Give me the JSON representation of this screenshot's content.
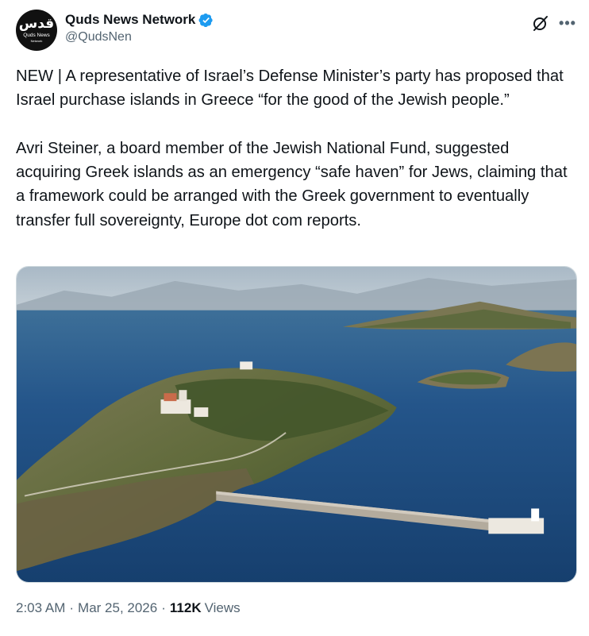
{
  "author": {
    "display_name": "Quds News Network",
    "handle": "@QudsNen",
    "verified": true,
    "avatar": {
      "logo_text": "قدس",
      "line1": "Quds News",
      "line2": "Network"
    }
  },
  "icons": {
    "verified": "verified-badge-icon",
    "grok": "grok-icon",
    "more": "more-icon"
  },
  "colors": {
    "verified_blue": "#1d9bf0",
    "text": "#0f1419",
    "muted": "#536471"
  },
  "tweet": {
    "paragraph1": "NEW | A representative of Israel’s Defense Minister’s party has proposed that Israel purchase islands in Greece “for the good of the Jewish people.”",
    "paragraph2": "Avri Steiner, a board member of the Jewish National Fund, suggested acquiring Greek islands as an emergency “safe haven” for Jews, claiming that a framework could be arranged with the Greek government to eventually transfer full sovereignty, Europe dot com reports."
  },
  "meta": {
    "time": "2:03 AM",
    "separator": "·",
    "date": "Mar 25, 2026",
    "views_count": "112K",
    "views_label": "Views"
  }
}
